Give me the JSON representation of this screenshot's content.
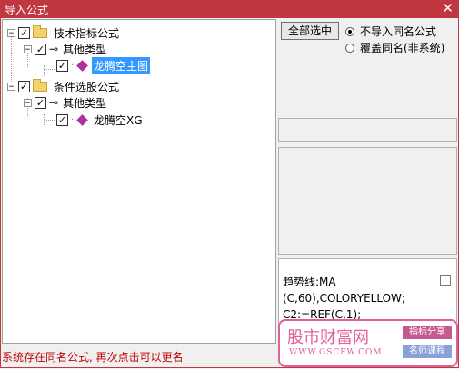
{
  "window": {
    "title": "导入公式",
    "close_symbol": "✕"
  },
  "tree": {
    "nodes": [
      {
        "label": "技术指标公式",
        "expander": "−",
        "checked": "✓"
      },
      {
        "label": "其他类型",
        "expander": "−",
        "checked": "✓"
      },
      {
        "label": "龙腾空主图",
        "checked": "✓",
        "selected": true
      },
      {
        "label": "条件选股公式",
        "expander": "−",
        "checked": "✓"
      },
      {
        "label": "其他类型",
        "expander": "−",
        "checked": "✓"
      },
      {
        "label": "龙腾空XG",
        "checked": "✓"
      }
    ]
  },
  "options": {
    "select_all_label": "全部选中",
    "radio_no_import": "不导入同名公式",
    "radio_overwrite": "覆盖同名(非系统)",
    "selected_radio": "no_import"
  },
  "formula": {
    "lines": [
      "趋势线:MA",
      "(C,60),COLORYELLOW;",
      "C2:=REF(C,1);"
    ]
  },
  "watermark": {
    "title": "股市财富网",
    "url": "WWW.GSCFW.COM",
    "tag1": "指标分享",
    "tag2": "名师课程",
    "tag1_color": "#c45a90",
    "tag2_color": "#8aa0d8"
  },
  "status": "系统存在同名公式, 再次点击可以更名"
}
